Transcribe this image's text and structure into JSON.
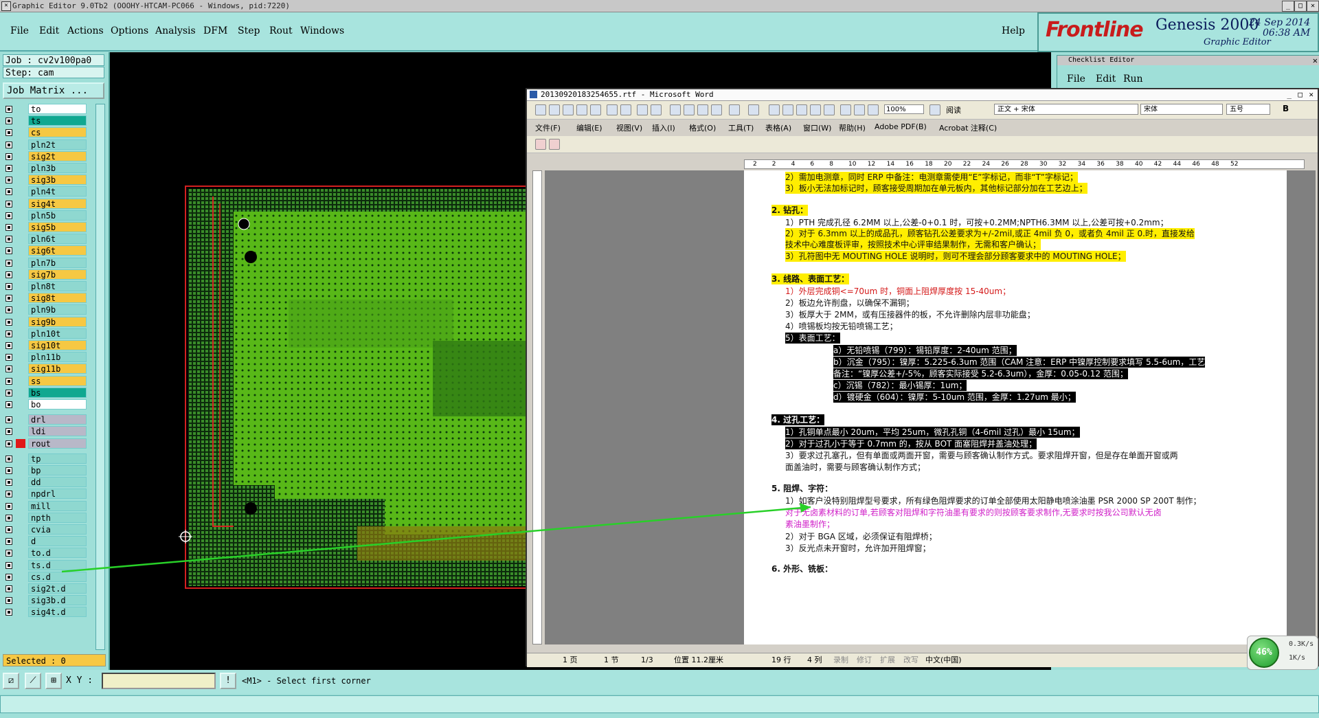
{
  "titlebar": {
    "text": "Graphic Editor 9.0Tb2 (OOOHY-HTCAM-PC066 - Windows, pid:7220)"
  },
  "menu": [
    "File",
    "Edit",
    "Actions",
    "Options",
    "Analysis",
    "DFM",
    "Step",
    "Rout",
    "Windows"
  ],
  "help": "Help",
  "brand": {
    "logo": "Frontline",
    "product": "Genesis 2000",
    "subtitle": "Graphic Editor",
    "date": "24 Sep 2014",
    "time": "06:38 AM"
  },
  "job": {
    "job": "Job : cv2v100pa0",
    "step": "Step: cam",
    "matrix": "Job Matrix ..."
  },
  "layers": [
    {
      "name": "to",
      "color": "#ffffff"
    },
    {
      "name": "ts",
      "color": "#10a890"
    },
    {
      "name": "cs",
      "color": "#f6c843"
    },
    {
      "name": "pln2t",
      "color": "#8fd8d0"
    },
    {
      "name": "sig2t",
      "color": "#f6c843"
    },
    {
      "name": "pln3b",
      "color": "#8fd8d0"
    },
    {
      "name": "sig3b",
      "color": "#f6c843"
    },
    {
      "name": "pln4t",
      "color": "#8fd8d0"
    },
    {
      "name": "sig4t",
      "color": "#f6c843"
    },
    {
      "name": "pln5b",
      "color": "#8fd8d0"
    },
    {
      "name": "sig5b",
      "color": "#f6c843"
    },
    {
      "name": "pln6t",
      "color": "#8fd8d0"
    },
    {
      "name": "sig6t",
      "color": "#f6c843"
    },
    {
      "name": "pln7b",
      "color": "#8fd8d0"
    },
    {
      "name": "sig7b",
      "color": "#f6c843"
    },
    {
      "name": "pln8t",
      "color": "#8fd8d0"
    },
    {
      "name": "sig8t",
      "color": "#f6c843"
    },
    {
      "name": "pln9b",
      "color": "#8fd8d0"
    },
    {
      "name": "sig9b",
      "color": "#f6c843"
    },
    {
      "name": "pln10t",
      "color": "#8fd8d0"
    },
    {
      "name": "sig10t",
      "color": "#f6c843"
    },
    {
      "name": "pln11b",
      "color": "#8fd8d0"
    },
    {
      "name": "sig11b",
      "color": "#f6c843"
    },
    {
      "name": "ss",
      "color": "#f6c843"
    },
    {
      "name": "bs",
      "color": "#10a890"
    },
    {
      "name": "bo",
      "color": "#ffffff"
    },
    {
      "name": "drl",
      "color": "#b8b8c8"
    },
    {
      "name": "ldi",
      "color": "#b8b8c8"
    },
    {
      "name": "rout",
      "color": "#b8b8c8"
    },
    {
      "name": "tp",
      "color": "#8fd8d0"
    },
    {
      "name": "bp",
      "color": "#8fd8d0"
    },
    {
      "name": "dd",
      "color": "#8fd8d0"
    },
    {
      "name": "npdrl",
      "color": "#8fd8d0"
    },
    {
      "name": "mill",
      "color": "#8fd8d0"
    },
    {
      "name": "npth",
      "color": "#8fd8d0"
    },
    {
      "name": "cvia",
      "color": "#8fd8d0"
    },
    {
      "name": "d",
      "color": "#8fd8d0"
    },
    {
      "name": "to.d",
      "color": "#8fd8d0"
    },
    {
      "name": "ts.d",
      "color": "#8fd8d0"
    },
    {
      "name": "cs.d",
      "color": "#8fd8d0"
    },
    {
      "name": "sig2t.d",
      "color": "#8fd8d0"
    },
    {
      "name": "sig3b.d",
      "color": "#8fd8d0"
    },
    {
      "name": "sig4t.d",
      "color": "#8fd8d0"
    }
  ],
  "selected": "Selected : 0",
  "xy_label": "X Y :",
  "prompt": "<M1> - Select first corner",
  "checklist": {
    "title": "Checklist Editor",
    "menu": [
      "File",
      "Edit",
      "Run"
    ]
  },
  "word": {
    "title": "20130920183254655.rtf - Microsoft Word",
    "menu": [
      "文件(F)",
      "编辑(E)",
      "视图(V)",
      "插入(I)",
      "格式(O)",
      "工具(T)",
      "表格(A)",
      "窗口(W)",
      "帮助(H)",
      "Adobe PDF(B)",
      "Acrobat 注释(C)"
    ],
    "zoom": "100%",
    "read": "阅读",
    "style": "正文 + 宋体",
    "font": "宋体",
    "size": "五号",
    "ruler": [
      "2",
      "2",
      "4",
      "6",
      "8",
      "10",
      "12",
      "14",
      "16",
      "18",
      "20",
      "22",
      "24",
      "26",
      "28",
      "30",
      "32",
      "34",
      "36",
      "38",
      "40",
      "42",
      "44",
      "46",
      "48",
      "52"
    ],
    "lines": [
      "2）需加电测章，同时 ERP 中备注：电测章需使用“E”字标记，而非“T”字标记；",
      "3）板小无法加标记时，顾客接受周期加在单元板内，其他标记部分加在工艺边上；",
      "2.  钻孔：",
      "1）PTH 完成孔径 6.2MM 以上,公差-0+0.1 时，可按+0.2MM;NPTH6.3MM 以上,公差可按+0.2mm；",
      "2）对于 6.3mm 以上的成品孔，顾客钻孔公差要求为+/-2mil,或正 4mil 负 0，或者负 4mil 正 0.时，直接发给",
      "技术中心难度板评审，按照技术中心评审结果制作，无需和客户确认；",
      "3）孔符图中无 MOUTING HOLE 说明时，则可不理会部分顾客要求中的 MOUTING HOLE；",
      "3.  线路、表面工艺：",
      "1）外层完成铜<=70um 时，铜面上阻焊厚度按 15-40um；",
      "2）板边允许削盘，以确保不漏铜；",
      "3）板厚大于 2MM，或有压接器件的板，不允许删除内层非功能盘；",
      "4）喷锡板均按无铅喷锡工艺；",
      "5）表面工艺：",
      "a）无铅喷锡（799）：锡铅厚度：2-40um 范围；",
      "b）沉金（795）：镍厚：5.225-6.3um 范围（CAM 注意：ERP 中镍厚控制要求填写 5.5-6um，工艺",
      "备注：“镍厚公差+/-5%，顾客实际接受 5.2-6.3um），金厚：0.05-0.12 范围；",
      "c）沉锡（782）：最小锡厚：1um；",
      "d）镀硬金（604）：镍厚：5-10um 范围，金厚：1.27um 最小；",
      "4.  过孔工艺：",
      "1）孔铜单点最小 20um，平均 25um，微孔孔铜（4-6mil 过孔）最小 15um；",
      "2）对于过孔小于等于 0.7mm 的，按从 BOT 面塞阻焊并盖油处理；",
      "3）要求过孔塞孔，但有单面或两面开窗，需要与顾客确认制作方式。要求阻焊开窗，但是存在单面开窗或两",
      "面盖油时，需要与顾客确认制作方式；",
      "5.  阻焊、字符：",
      "1）如客户没特别阻焊型号要求，所有绿色阻焊要求的订单全部使用太阳静电喷涂油墨 PSR 2000 SP 200T 制作；",
      "对于无卤素材料的订单,若顾客对阻焊和字符油墨有要求的则按顾客要求制作,无要求时按我公司默认无卤",
      "素油墨制作；",
      "2）对于 BGA 区域，必须保证有阻焊桥；",
      "3）反光点未开窗时，允许加开阻焊窗；",
      "6.  外形、铣板："
    ],
    "status": [
      "1 页",
      "1 节",
      "1/3",
      "位置 11.2厘米",
      "19 行",
      "4 列",
      "录制",
      "修订",
      "扩展",
      "改写",
      "中文(中国)"
    ]
  },
  "netbadge": {
    "percent": "46%",
    "up": "0.3K/s",
    "down": "1K/s"
  }
}
